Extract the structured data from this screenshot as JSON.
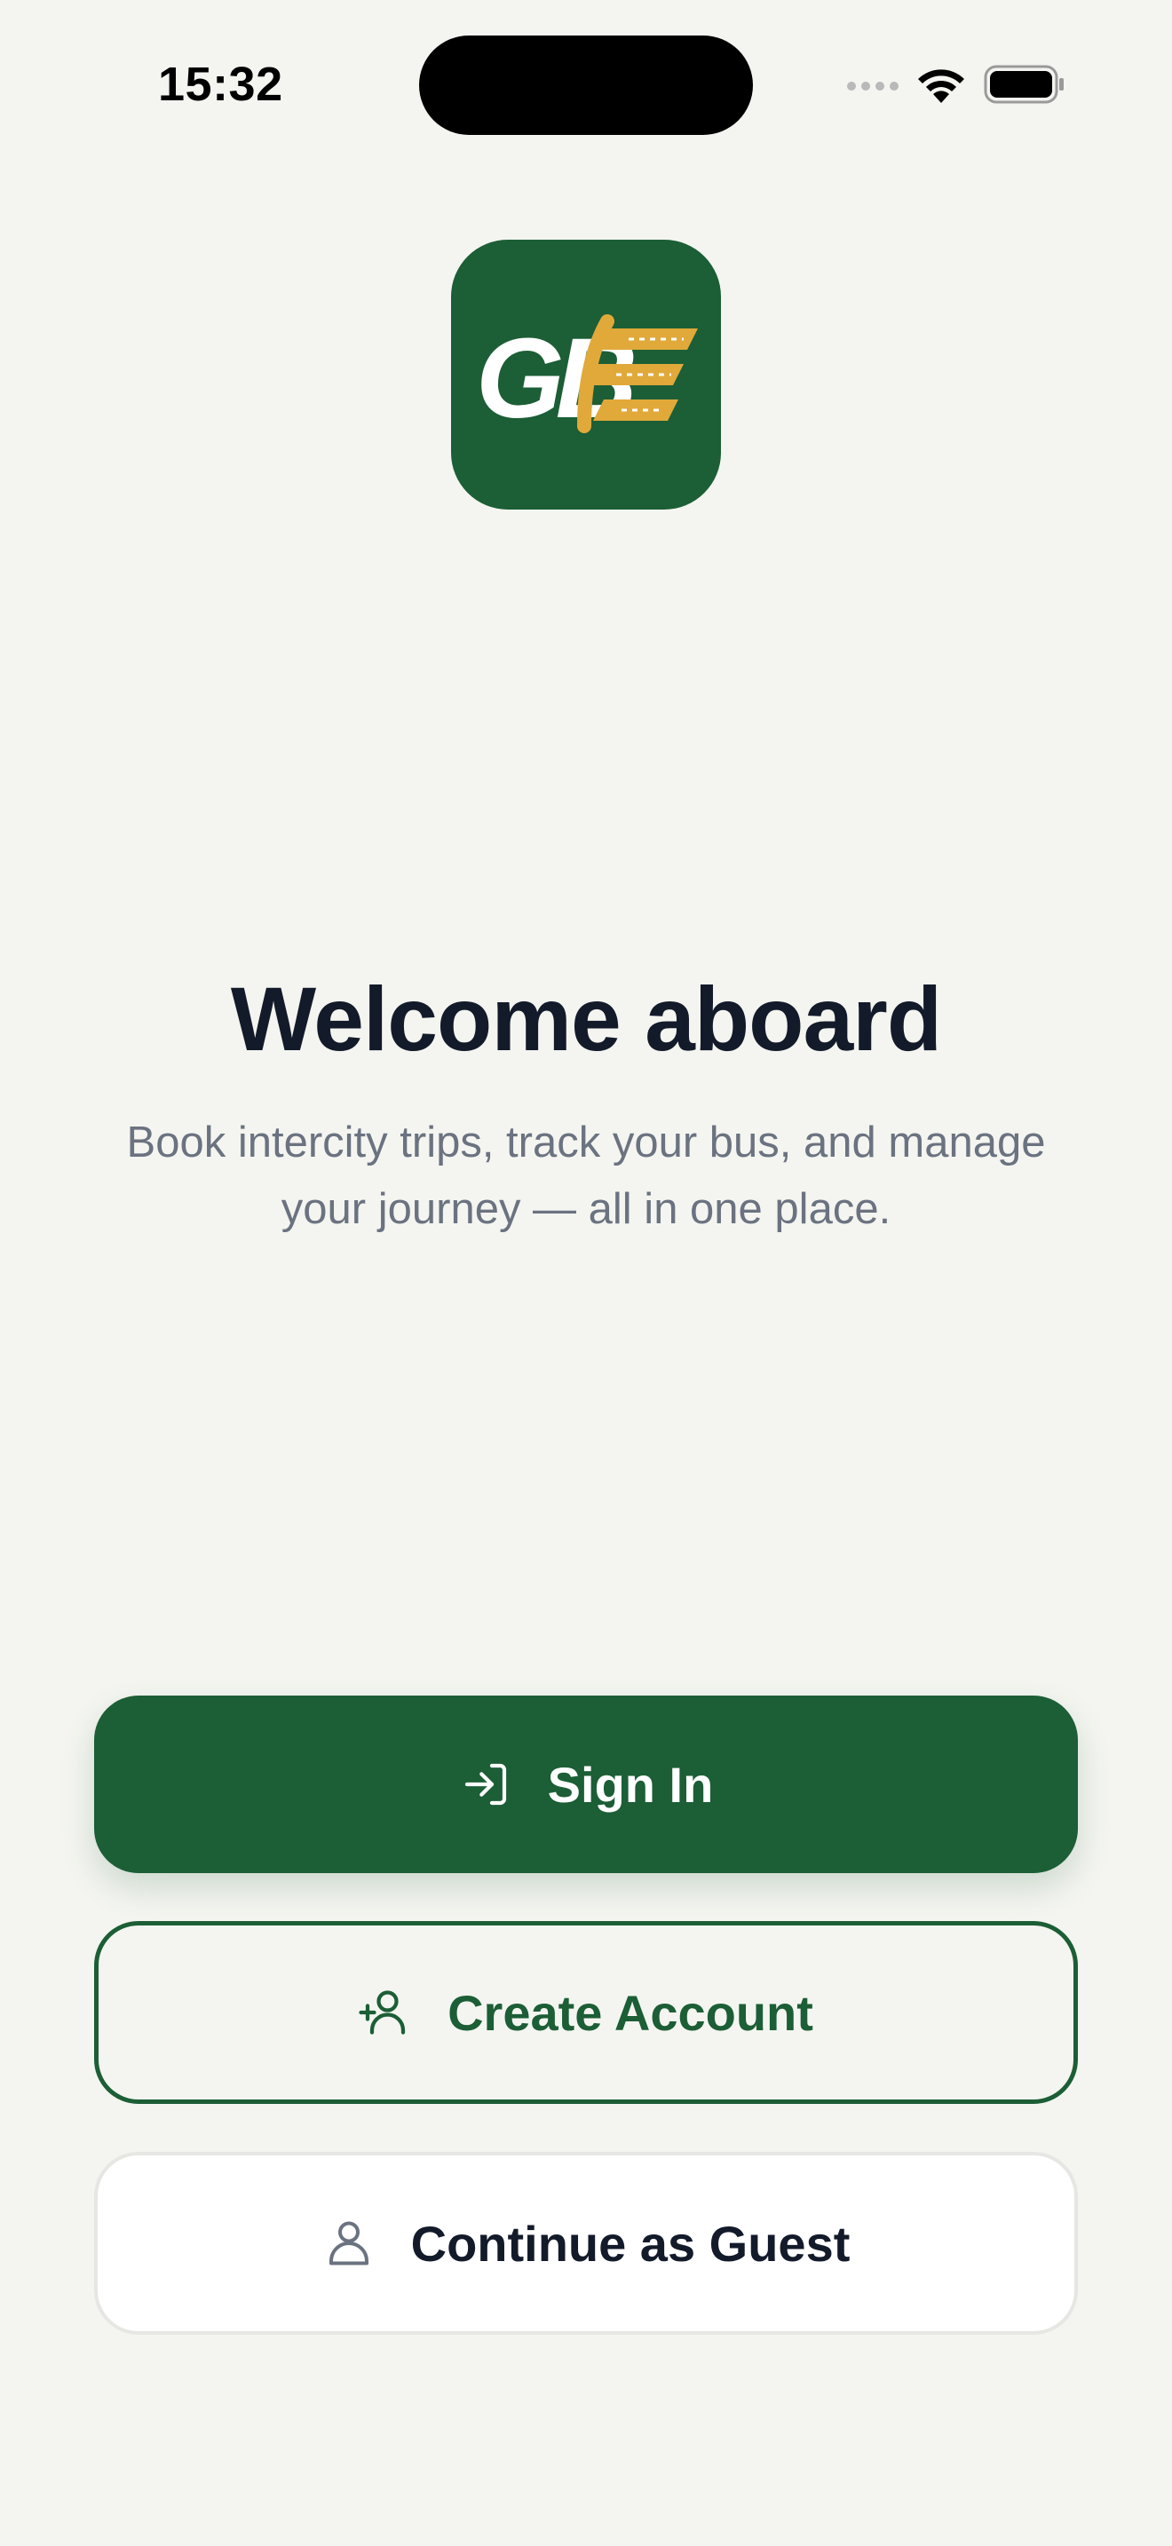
{
  "status_bar": {
    "time": "15:32"
  },
  "logo": {
    "letters": "GB",
    "accent_color": "#e0a93a",
    "background_color": "#1c5e36"
  },
  "welcome": {
    "title": "Welcome aboard",
    "subtitle_line1": "Book intercity trips, track your bus, and manage",
    "subtitle_line2": "your journey — all in one place."
  },
  "actions": {
    "sign_in_label": "Sign In",
    "sign_in_icon": "sign-in-icon",
    "create_account_label": "Create Account",
    "create_account_icon": "add-user-icon",
    "guest_label": "Continue as Guest",
    "guest_icon": "user-icon"
  },
  "colors": {
    "brand": "#1c5e36",
    "background": "#f4f5f0",
    "text_dark": "#131a2a",
    "text_muted": "#6b7280"
  }
}
